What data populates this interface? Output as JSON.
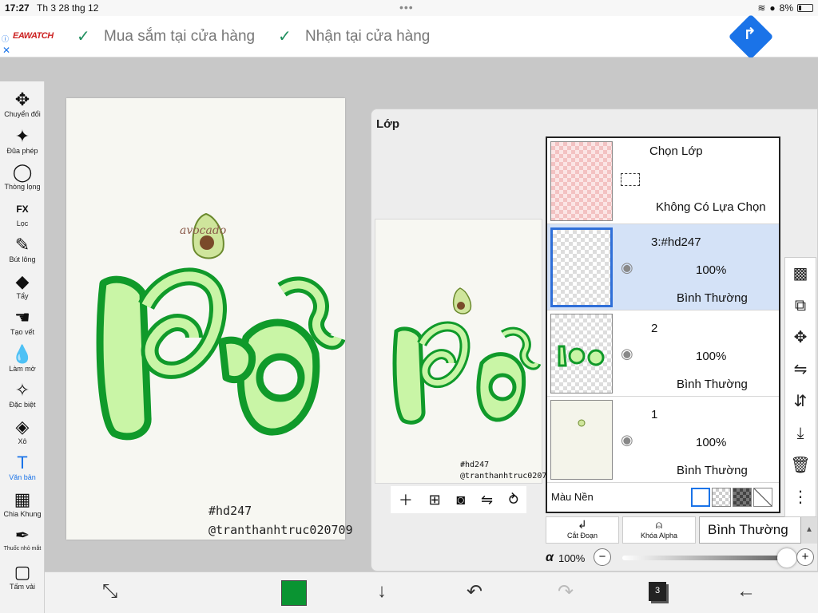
{
  "status": {
    "time": "17:27",
    "date": "Th 3 28 thg 12",
    "battery": "8%"
  },
  "ad": {
    "brand": "EAWATCH",
    "item1": "Mua sắm tại cửa hàng",
    "item2": "Nhận tại cửa hàng"
  },
  "tools": [
    {
      "label": "Chuyển đổi",
      "icon": "✥"
    },
    {
      "label": "Đũa phép",
      "icon": "✦"
    },
    {
      "label": "Thòng lọng",
      "icon": "◯"
    },
    {
      "label": "Lọc",
      "icon": "FX"
    },
    {
      "label": "Bút lông",
      "icon": "✎"
    },
    {
      "label": "Tẩy",
      "icon": "◆"
    },
    {
      "label": "Tạo vết",
      "icon": "☚"
    },
    {
      "label": "Làm mờ",
      "icon": "💧"
    },
    {
      "label": "Đặc biệt",
      "icon": "✧"
    },
    {
      "label": "Xô",
      "icon": "◈"
    },
    {
      "label": "Văn bản",
      "icon": "T"
    },
    {
      "label": "Chia Khung",
      "icon": "▦"
    },
    {
      "label": "Thuốc nhỏ mắt",
      "icon": "✒"
    },
    {
      "label": "Tấm vải",
      "icon": "▢"
    }
  ],
  "canvas": {
    "avocado_text": "avocado",
    "big_text": "Bơ",
    "caption1": "#hd247",
    "caption2": "@tranthanhtruc020709"
  },
  "layers_panel": {
    "title": "Lớp",
    "selection": {
      "name": "Chọn Lớp",
      "status": "Không Có Lựa Chọn"
    },
    "layers": [
      {
        "name": "3:#hd247",
        "opacity": "100%",
        "mode": "Bình Thường"
      },
      {
        "name": "2",
        "opacity": "100%",
        "mode": "Bình Thường"
      },
      {
        "name": "1",
        "opacity": "100%",
        "mode": "Bình Thường"
      }
    ],
    "background_label": "Màu Nền",
    "clip_label": "Cắt Đoạn",
    "alpha_lock_label": "Khóa Alpha",
    "blend_mode": "Bình Thường",
    "alpha_symbol": "α",
    "alpha_value": "100%",
    "preview_caption1": "#hd247",
    "preview_caption2": "@tranthanhtruc020709"
  },
  "bottom": {
    "layer_count": "3"
  },
  "colors": {
    "current": "#0a9432",
    "accent": "#1a73e8"
  }
}
